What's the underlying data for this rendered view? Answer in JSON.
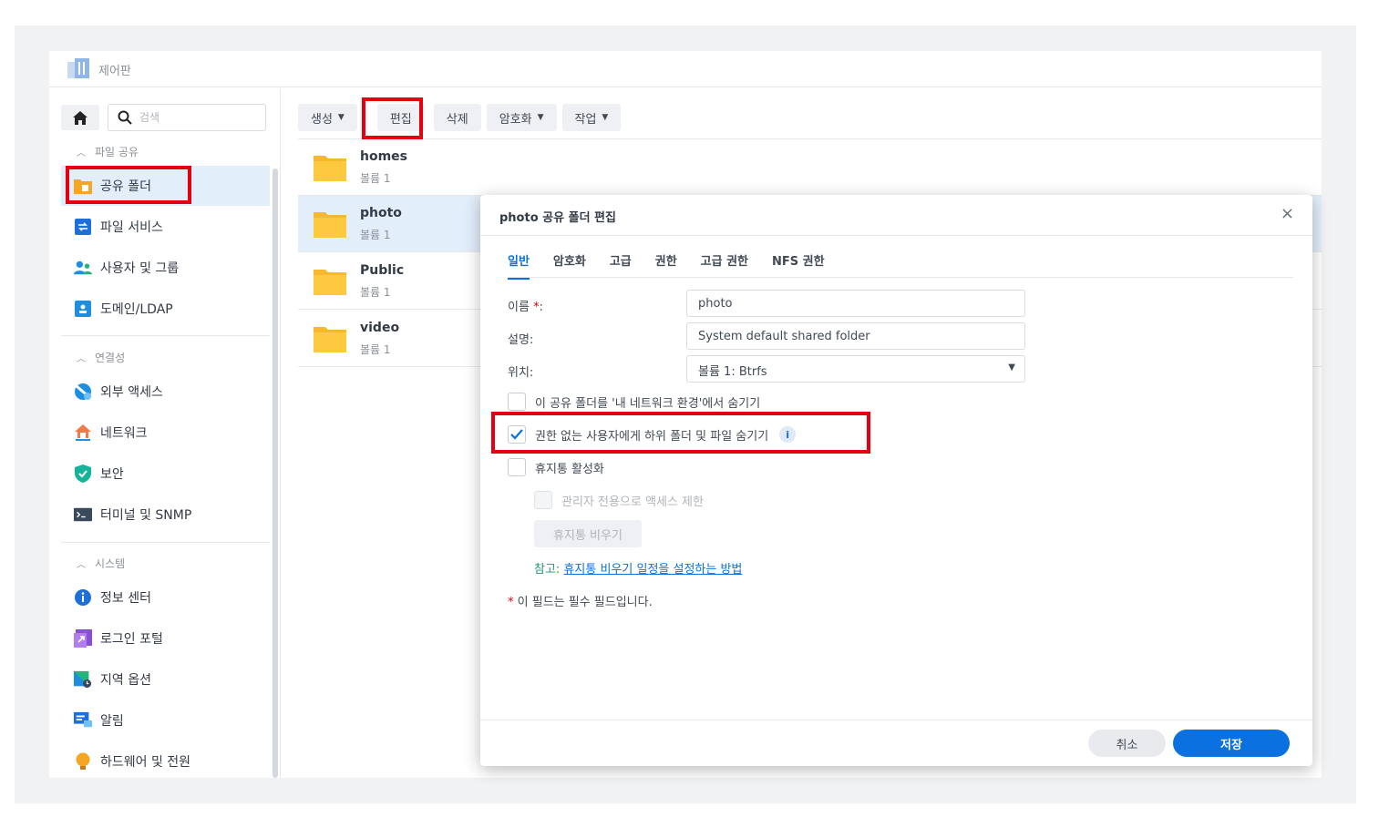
{
  "window": {
    "title": "제어판"
  },
  "sidebar": {
    "search_placeholder": "검색",
    "sections": [
      {
        "label": "파일 공유",
        "items": [
          "공유 폴더",
          "파일 서비스",
          "사용자 및 그룹",
          "도메인/LDAP"
        ]
      },
      {
        "label": "연결성",
        "items": [
          "외부 액세스",
          "네트워크",
          "보안",
          "터미널 및 SNMP"
        ]
      },
      {
        "label": "시스템",
        "items": [
          "정보 센터",
          "로그인 포털",
          "지역 옵션",
          "알림",
          "하드웨어 및 전원"
        ]
      }
    ],
    "active_item": "공유 폴더"
  },
  "toolbar": {
    "create": "생성",
    "edit": "편집",
    "delete": "삭제",
    "encrypt": "암호화",
    "action": "작업"
  },
  "folders": [
    {
      "name": "homes",
      "volume": "볼륨 1"
    },
    {
      "name": "photo",
      "volume": "볼륨 1"
    },
    {
      "name": "Public",
      "volume": "볼륨 1"
    },
    {
      "name": "video",
      "volume": "볼륨 1"
    }
  ],
  "dialog": {
    "title": "photo 공유 폴더 편집",
    "close": "×",
    "tabs": [
      "일반",
      "암호화",
      "고급",
      "권한",
      "고급 권한",
      "NFS 권한"
    ],
    "active_tab": "일반",
    "name_label": "이름",
    "name_req": "*",
    "name_colon": ":",
    "name_value": "photo",
    "desc_label": "설명:",
    "desc_value": "System default shared folder",
    "location_label": "위치:",
    "location_value": "볼륨 1:  Btrfs",
    "hide_network": {
      "label": "이 공유 폴더를 '내 네트워크 환경'에서 숨기기",
      "checked": false
    },
    "hide_subfolders": {
      "label": "권한 없는 사용자에게 하위 폴더 및 파일 숨기기",
      "checked": true
    },
    "recycle_bin": {
      "label": "휴지통 활성화",
      "checked": false
    },
    "admin_only": {
      "label": "관리자 전용으로 액세스 제한",
      "checked": false,
      "disabled": true
    },
    "empty_bin": "휴지통 비우기",
    "note_prefix": "참고:",
    "note_link": "휴지통 비우기 일정을 설정하는 방법",
    "required_note_star": "*",
    "required_note": "이 필드는 필수 필드입니다.",
    "cancel": "취소",
    "save": "저장"
  },
  "colors": {
    "accent": "#0b70e0",
    "highlight": "#e5000f",
    "selected_row": "#e3eefb"
  }
}
